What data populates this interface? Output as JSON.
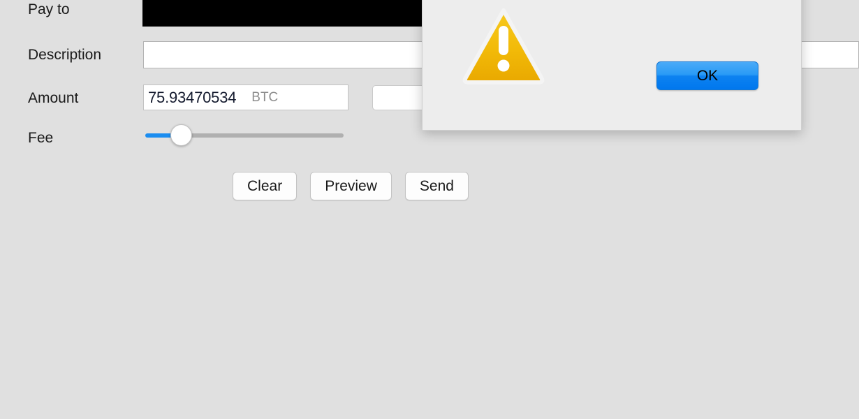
{
  "app": {
    "background_color": "#e0e0e0",
    "accent_color": "#1b8df0"
  },
  "send_form": {
    "labels": {
      "pay_to": "Pay to",
      "description": "Description",
      "amount": "Amount",
      "fee": "Fee"
    },
    "pay_to": {
      "value": "",
      "state": "redacted"
    },
    "description": {
      "value": "",
      "placeholder": ""
    },
    "amount": {
      "value": "75.93470534",
      "unit": "BTC"
    },
    "amount_fiat": {
      "value": ""
    },
    "fee": {
      "slider_position_percent": 16
    },
    "buttons": {
      "clear": "Clear",
      "preview": "Preview",
      "send": "Send"
    }
  },
  "warning_dialog": {
    "icon": "warning-triangle-icon",
    "icon_color": "#f0b400",
    "message": "",
    "ok_label": "OK",
    "ok_color": "#0d82f0"
  }
}
